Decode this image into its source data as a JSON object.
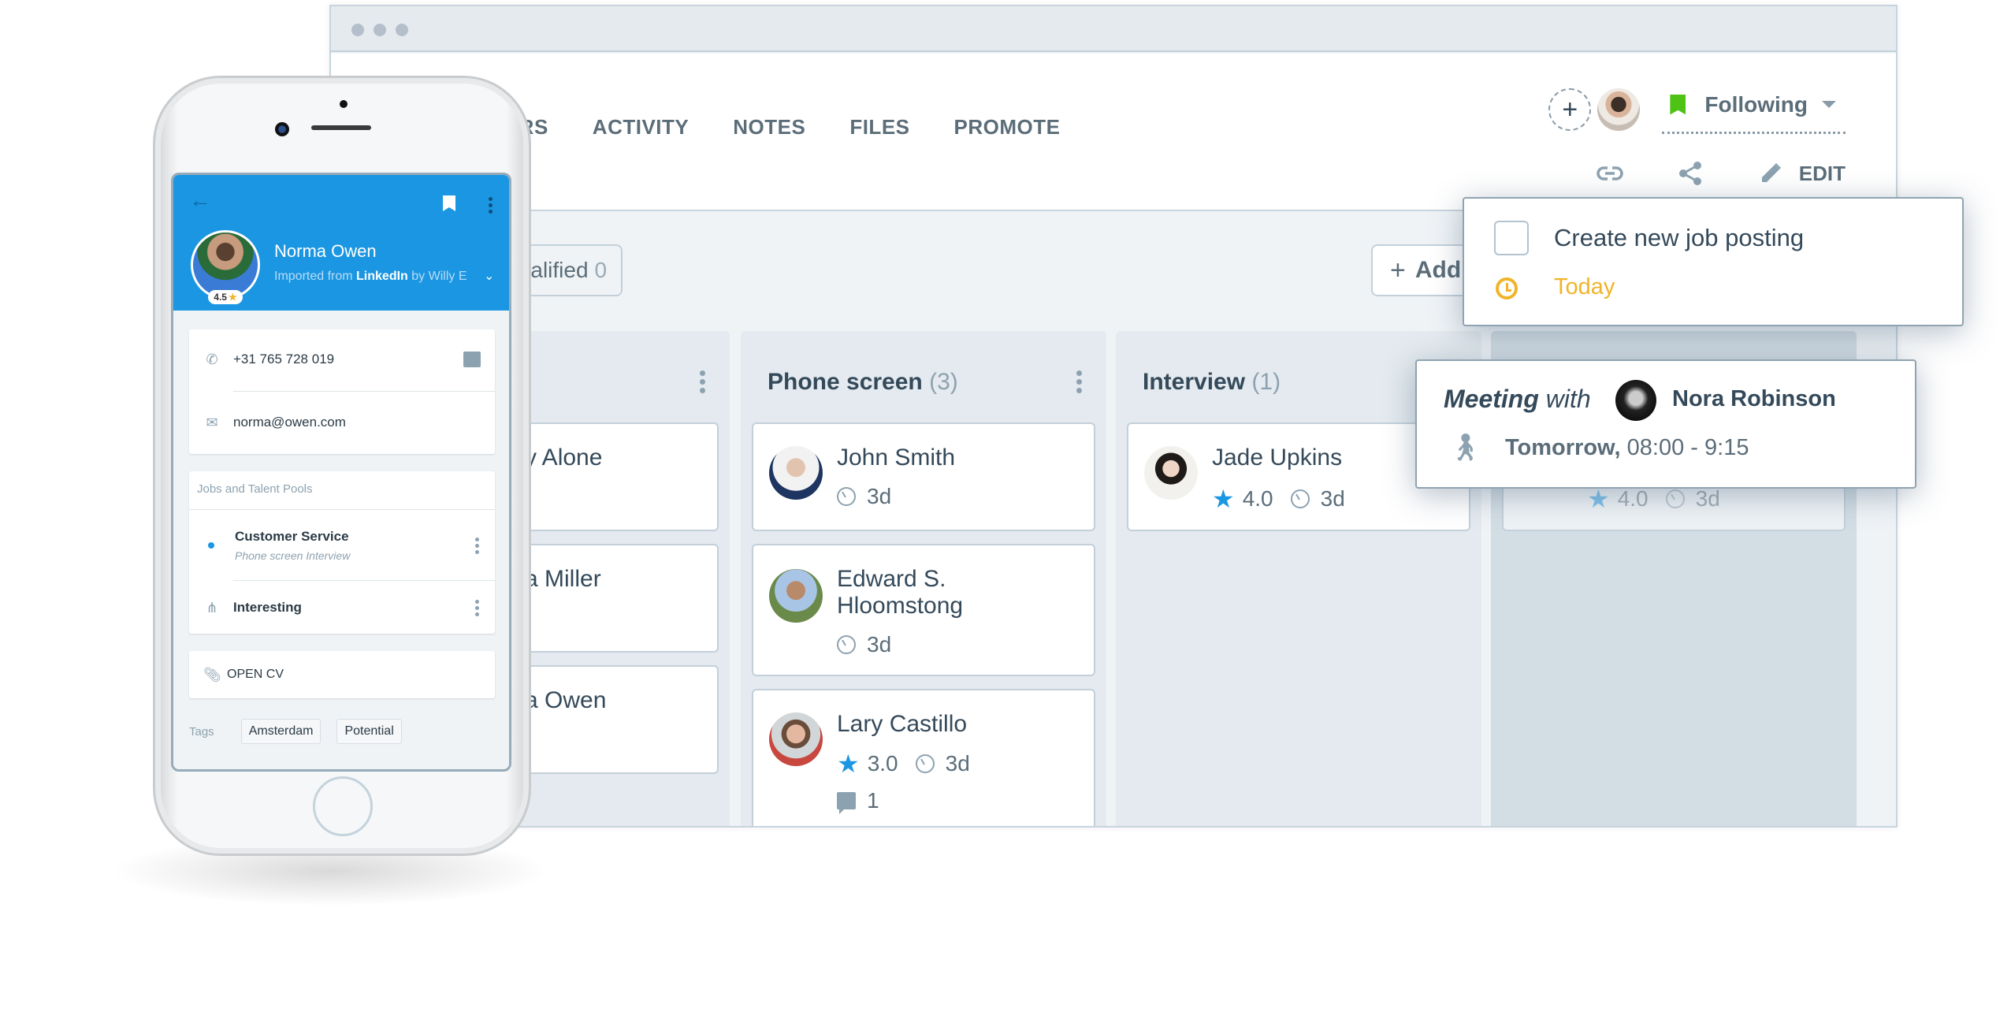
{
  "window": {
    "tabs": [
      "LTERS",
      "ACTIVITY",
      "NOTES",
      "FILES",
      "PROMOTE"
    ],
    "header": {
      "add_follower_icon": "plus-icon",
      "follow_label": "Following",
      "follow_color": "#4fc315",
      "edit_label": "EDIT",
      "action_icons": [
        "link-icon",
        "share-icon",
        "pencil-icon"
      ]
    },
    "filter_chip": {
      "label": "isqualified",
      "count": "0"
    },
    "add_button": {
      "plus": "+",
      "label": "Add"
    },
    "columns": [
      {
        "title": "",
        "count": "",
        "cards": [
          {
            "name": "y Alone"
          },
          {
            "name": "a Miller"
          },
          {
            "name": "a Owen"
          }
        ]
      },
      {
        "title": "Phone screen",
        "count": "(3)",
        "cards": [
          {
            "name": "John Smith",
            "time": "3d"
          },
          {
            "name": "Edward S. Hloomstong",
            "time": "3d"
          },
          {
            "name": "Lary Castillo",
            "rating": "3.0",
            "time": "3d",
            "comments": "1"
          }
        ]
      },
      {
        "title": "Interview",
        "count": "(1)",
        "cards": [
          {
            "name": "Jade Upkins",
            "rating": "4.0",
            "time": "3d"
          }
        ]
      },
      {
        "title": "",
        "count": "",
        "cards": [
          {
            "rating": "4.0",
            "time": "3d"
          }
        ]
      }
    ],
    "task_popup": {
      "title": "Create new job posting",
      "due": "Today",
      "due_color": "#f0b429"
    },
    "meeting_popup": {
      "label_bold": "Meeting",
      "label_rest": " with",
      "person": "Nora Robinson",
      "when_bold": "Tomorrow,",
      "when_rest": " 08:00 - 9:15"
    }
  },
  "phone": {
    "back_icon": "←",
    "candidate": {
      "name": "Norma Owen",
      "rating": "4.5",
      "source_prefix": "Imported from ",
      "source_name": "LinkedIn",
      "source_suffix": " by Willy E"
    },
    "phone_number": "+31 765 728 019",
    "email": "norma@owen.com",
    "jobs_section_label": "Jobs and Talent Pools",
    "jobs": [
      {
        "title": "Customer Service",
        "stage": "Phone screen Interview"
      },
      {
        "title": "Interesting"
      }
    ],
    "open_cv_label": "OPEN CV",
    "tags_label": "Tags",
    "tags": [
      "Amsterdam",
      "Potential"
    ],
    "accent_color": "#1b96e2"
  }
}
